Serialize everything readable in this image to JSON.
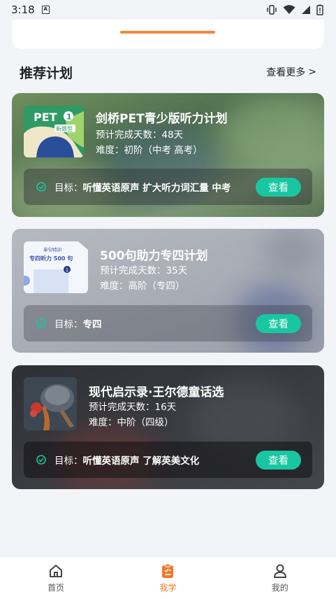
{
  "status_bar": {
    "time": "3:18",
    "app_icon_letter": "A",
    "icons": [
      "vibrate-icon",
      "wifi-icon",
      "signal-icon",
      "battery-icon"
    ]
  },
  "section": {
    "title": "推荐计划",
    "see_more": "查看更多",
    "see_more_arrow": ">"
  },
  "plans": [
    {
      "title": "剑桥PET青少版听力计划",
      "days": "预计完成天数：48天",
      "level": "难度：初阶（中考 高考）",
      "goal_label": "目标：",
      "goal": "听懂英语原声 扩大听力词汇量 中考",
      "button": "查看",
      "cover": {
        "badge": "PET",
        "badge_num": "1",
        "sub": "新题型"
      }
    },
    {
      "title": "500句助力专四计划",
      "days": "预计完成天数：35天",
      "level": "难度：高阶（专四）",
      "goal_label": "目标：",
      "goal": "专四",
      "button": "查看",
      "cover": {
        "line1": "单句特训",
        "line2": "专四听力 500 句",
        "num": "1"
      }
    },
    {
      "title": "现代启示录·王尔德童话选",
      "days": "预计完成天数：16天",
      "level": "难度：中阶（四级）",
      "goal_label": "目标：",
      "goal": "听懂英语原声 了解英美文化",
      "button": "查看"
    }
  ],
  "bottom_nav": {
    "items": [
      {
        "label": "首页",
        "icon": "home-icon",
        "active": false
      },
      {
        "label": "我学",
        "icon": "study-list-icon",
        "active": true
      },
      {
        "label": "我的",
        "icon": "profile-icon",
        "active": false
      }
    ]
  },
  "colors": {
    "accent_green": "#18c7a1",
    "accent_orange": "#f07a28",
    "background": "#f3f4f8"
  }
}
